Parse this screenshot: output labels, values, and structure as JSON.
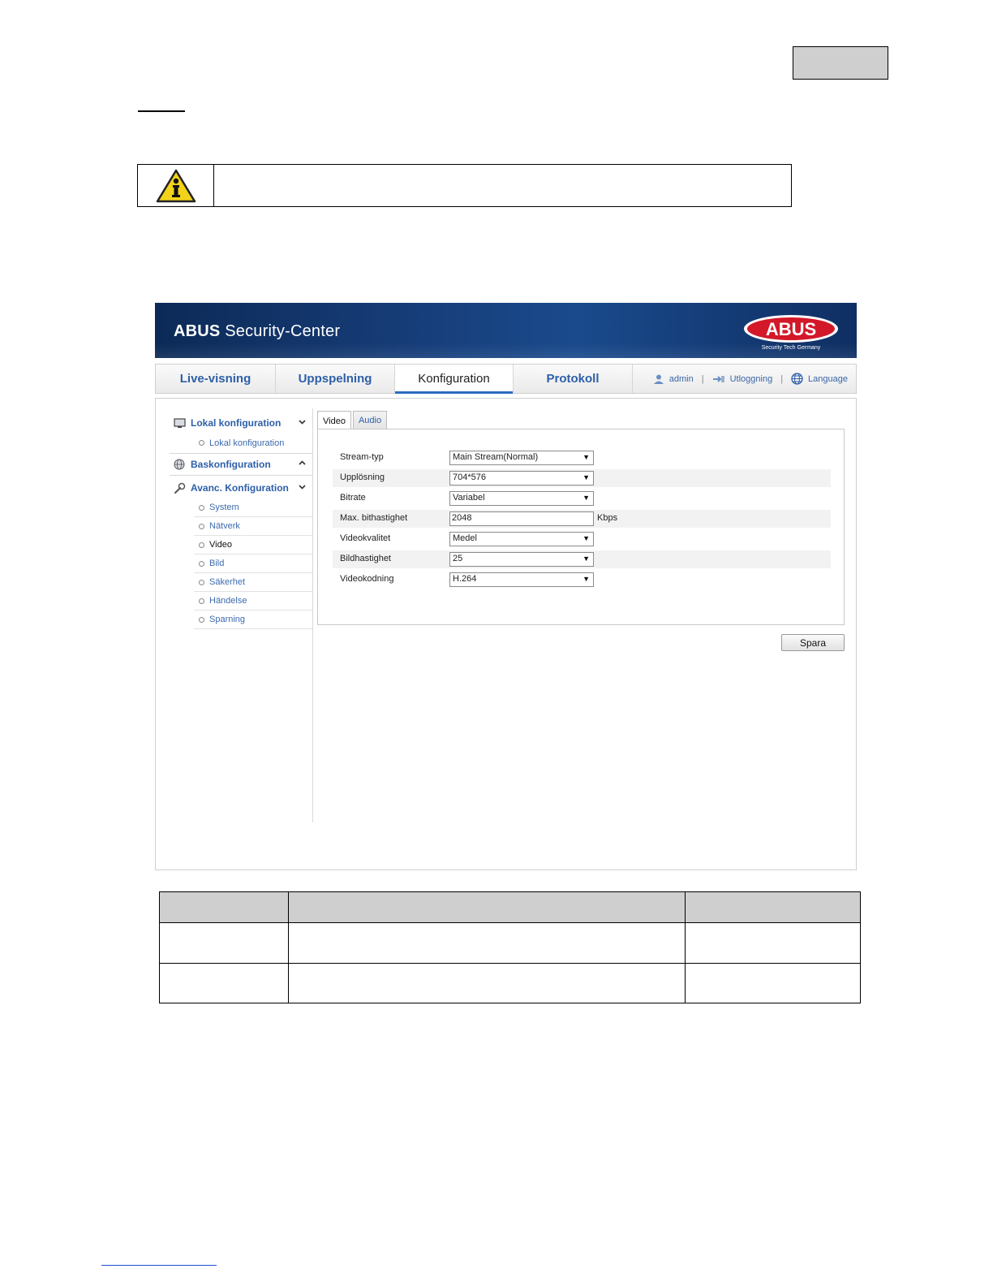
{
  "banner": {
    "title_bold": "ABUS",
    "title_rest": " Security-Center",
    "logo_text": "ABUS",
    "logo_tagline": "Security Tech Germany"
  },
  "topnav": {
    "tabs": [
      {
        "label": "Live-visning"
      },
      {
        "label": "Uppspelning"
      },
      {
        "label": "Konfiguration"
      },
      {
        "label": "Protokoll"
      }
    ],
    "active_index": 2,
    "user": "admin",
    "logout": "Utloggning",
    "language": "Language",
    "separator": "|"
  },
  "sidebar": {
    "groups": [
      {
        "label": "Lokal konfiguration",
        "icon": "monitor-icon",
        "chevron": "chevron-down-icon"
      },
      {
        "label": "Baskonfiguration",
        "icon": "globe-gear-icon",
        "chevron": "chevron-up-icon"
      },
      {
        "label": "Avanc. Konfiguration",
        "icon": "wrench-icon",
        "chevron": "chevron-down-icon"
      }
    ],
    "local_items": [
      "Lokal konfiguration"
    ],
    "advanced_items": [
      "System",
      "Nätverk",
      "Video",
      "Bild",
      "Säkerhet",
      "Händelse",
      "Sparning"
    ],
    "current_item": "Video"
  },
  "main": {
    "subtabs": [
      {
        "label": "Video"
      },
      {
        "label": "Audio"
      }
    ],
    "active_subtab": "Video",
    "fields": [
      {
        "label": "Stream-typ",
        "type": "select",
        "value": "Main Stream(Normal)"
      },
      {
        "label": "Upplösning",
        "type": "select",
        "value": "704*576"
      },
      {
        "label": "Bitrate",
        "type": "select",
        "value": "Variabel"
      },
      {
        "label": "Max. bithastighet",
        "type": "input",
        "value": "2048",
        "unit": "Kbps"
      },
      {
        "label": "Videokvalitet",
        "type": "select",
        "value": "Medel"
      },
      {
        "label": "Bildhastighet",
        "type": "select",
        "value": "25"
      },
      {
        "label": "Videokodning",
        "type": "select",
        "value": "H.264"
      }
    ],
    "save_label": "Spara"
  },
  "colors": {
    "banner_dark": "#0c2a57",
    "link_blue": "#2d5fa8",
    "accent": "#2d6cc0",
    "logo_red": "#d3182a"
  }
}
